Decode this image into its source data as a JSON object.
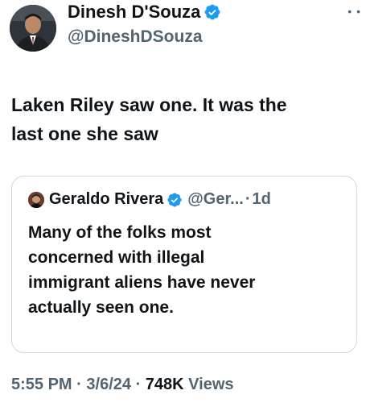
{
  "author": {
    "name": "Dinesh D'Souza",
    "handle": "@DineshDSouza",
    "verified_icon": "verified-badge-icon"
  },
  "tweet": {
    "text_line1": "Laken Riley saw one. It was the",
    "text_line2": "last one she saw"
  },
  "quote": {
    "name": "Geraldo Rivera",
    "handle": "@Ger...",
    "separator": "·",
    "time": "1d",
    "lines": [
      "Many of the folks most",
      "concerned with illegal",
      "immigrant aliens have never",
      "actually seen one."
    ]
  },
  "meta": {
    "time": "5:55 PM",
    "sep1": "·",
    "date": "3/6/24",
    "sep2": "·",
    "views_count": "748K",
    "views_label": "Views"
  },
  "colors": {
    "text": "#0f1419",
    "secondary": "#536471",
    "verified": "#1d9bf0",
    "border": "#cfd9de"
  }
}
